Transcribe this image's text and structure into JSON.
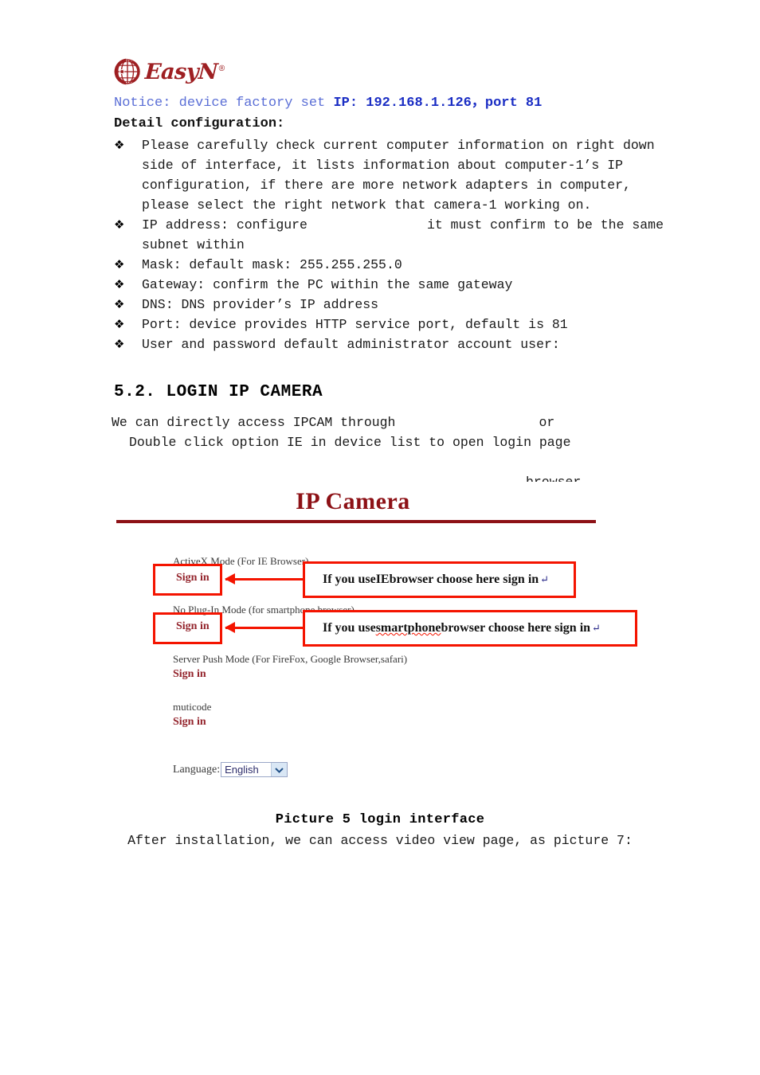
{
  "header": {
    "logo_text": "EasyN",
    "logo_registered": "®",
    "logo_color": "#9e1f22",
    "notice_lead": "Notice: device factory set ",
    "notice_strong": "IP: 192.168.1.126，port 81",
    "notice_lead_color": "#5b6fd6",
    "notice_strong_color": "#1b2ec4"
  },
  "detail": {
    "heading": "Detail configuration:",
    "bullet_glyph": "❖",
    "items": [
      {
        "text": "Please carefully check current computer information on right down side of interface, it lists information about computer-1’s IP configuration, if there are more network adapters in computer, please select the right network that camera-1 working on."
      },
      {
        "text_before_gap": "IP address: configure",
        "text_after_gap": "it must confirm to be the same subnet within",
        "has_gap": true
      },
      {
        "text": "Mask: default mask: 255.255.255.0"
      },
      {
        "text": "Gateway: confirm the PC within the same gateway"
      },
      {
        "text": "DNS: DNS provider’s IP address"
      },
      {
        "text": "Port: device provides HTTP service port, default is 81"
      },
      {
        "text": "User and password  default administrator account user:"
      }
    ]
  },
  "section": {
    "heading": "5.2. LOGIN IP CAMERA",
    "intro_line1_before": "We can directly access IPCAM through",
    "intro_line1_after": "or",
    "intro_line2": "Double click option IE in device list to open login page",
    "intro_line3": "browser"
  },
  "screenshot": {
    "title": "IP Camera",
    "title_color": "#8d1116",
    "rule_color": "#8d1116",
    "annotation_color": "#f41400",
    "modes": [
      {
        "label": "ActiveX Mode (For IE Browser)",
        "signin": "Sign in"
      },
      {
        "label": "No Plug-In Mode (for smartphone browser)",
        "signin": "Sign in"
      },
      {
        "label": "Server Push Mode (For FireFox, Google Browser,safari)",
        "signin": "Sign in"
      },
      {
        "label": "muticode",
        "signin": "Sign in"
      }
    ],
    "callouts": [
      {
        "prefix": "If you use ",
        "emphasis": "IE",
        "suffix": " browser choose here sign in",
        "pilcrow": "↵"
      },
      {
        "prefix": "If you use ",
        "emphasis": "smartphone",
        "suffix": " browser choose here sign in",
        "pilcrow": "↵"
      }
    ],
    "language": {
      "label": "Language:",
      "value": "English",
      "chevron": "chevron-down-icon"
    }
  },
  "footer": {
    "caption": "Picture 5 login interface",
    "after_text": "After installation, we can access video view page, as picture 7:"
  }
}
